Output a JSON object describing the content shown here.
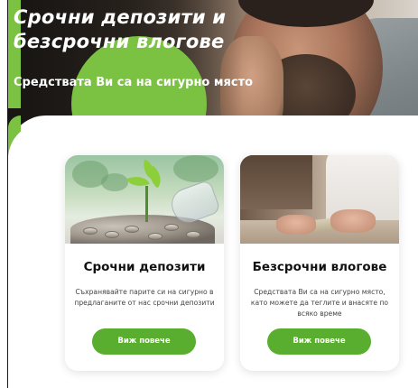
{
  "hero": {
    "title_line1": "Срочни депозити и",
    "title_line2": "безсрочни влогове",
    "subtitle": "Средствата Ви са на сигурно място"
  },
  "cards": [
    {
      "title": "Срочни депозити",
      "text": "Съхранявайте парите си на сигурно в предлаганите от нас срочни депозити",
      "button_label": "Виж повече"
    },
    {
      "title": "Безсрочни влогове",
      "text": "Средствата Ви са на сигурно място, като можете да теглите и внасяте по всяко време",
      "button_label": "Виж повече"
    }
  ],
  "colors": {
    "brand_green": "#7bc142",
    "button_green": "#5aae2f",
    "text_dark": "#111111",
    "text_muted": "#444444"
  },
  "icons": {
    "card1_image": "plant-coins-image",
    "card2_image": "hands-counting-money-image",
    "hero_image": "thoughtful-man-photo"
  }
}
